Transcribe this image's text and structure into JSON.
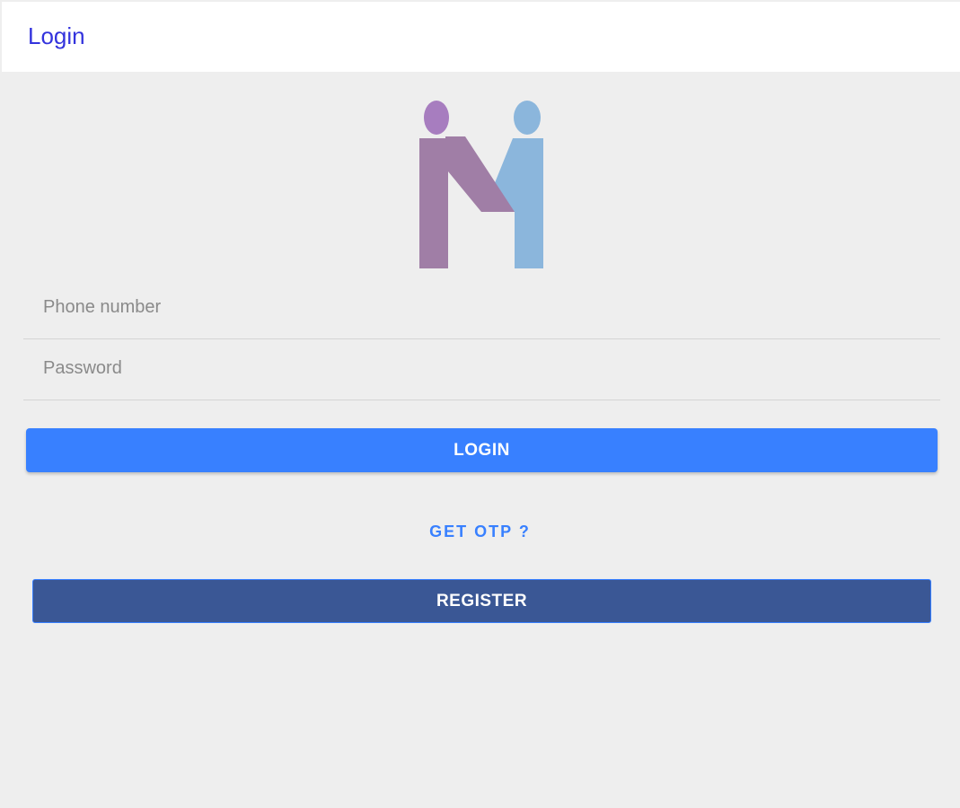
{
  "header": {
    "title": "Login"
  },
  "logo": {
    "name": "couple-logo",
    "colors": {
      "left_figure": "#a07ea6",
      "left_head": "#a77dbf",
      "right_figure": "#8bb6dc"
    }
  },
  "form": {
    "phone": {
      "placeholder": "Phone number",
      "value": ""
    },
    "password": {
      "placeholder": "Password",
      "value": ""
    },
    "login_label": "LOGIN",
    "otp_label": "GET OTP ?",
    "register_label": "REGISTER"
  },
  "colors": {
    "background": "#eeeeee",
    "header_bg": "#ffffff",
    "header_title": "#3333dd",
    "primary": "#3880ff",
    "register_bg": "#3a5795"
  }
}
